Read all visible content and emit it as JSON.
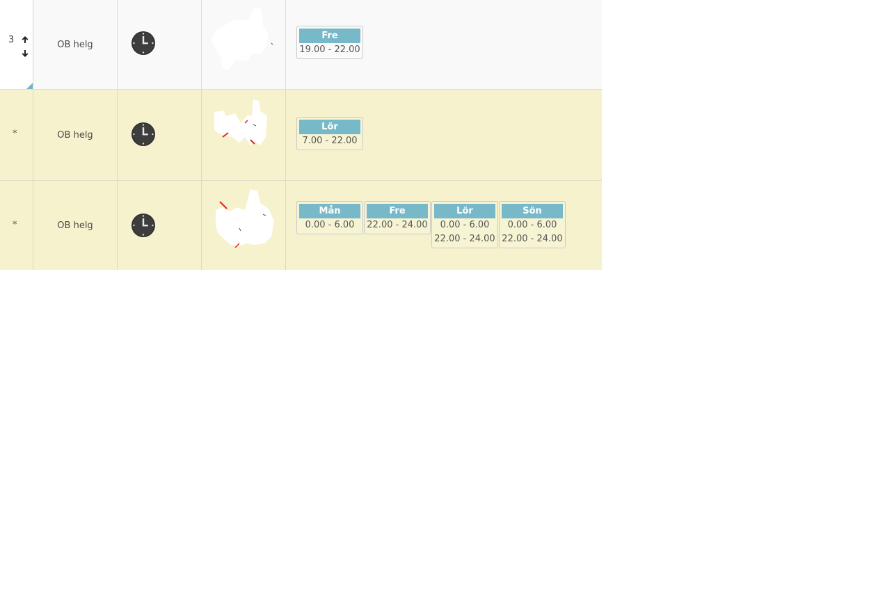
{
  "rows": [
    {
      "index": "3",
      "marker": "",
      "name": "OB helg",
      "icon": "clock-icon",
      "days": [
        {
          "day": "Fre",
          "times": [
            "19.00 - 22.00"
          ]
        }
      ]
    },
    {
      "index": "",
      "marker": "*",
      "name": "OB helg",
      "icon": "clock-icon",
      "days": [
        {
          "day": "Lör",
          "times": [
            "7.00 - 22.00"
          ]
        }
      ]
    },
    {
      "index": "",
      "marker": "*",
      "name": "OB helg",
      "icon": "clock-icon",
      "days": [
        {
          "day": "Mån",
          "times": [
            "0.00 - 6.00"
          ]
        },
        {
          "day": "Fre",
          "times": [
            "22.00 - 24.00"
          ]
        },
        {
          "day": "Lör",
          "times": [
            "0.00 - 6.00",
            "22.00 - 24.00"
          ]
        },
        {
          "day": "Sön",
          "times": [
            "0.00 - 6.00",
            "22.00 - 24.00"
          ]
        }
      ]
    }
  ],
  "colors": {
    "row_selected_bg": "#f9f9f9",
    "row_highlight_bg": "#f6f2cd",
    "day_header_bg": "#77b9c9",
    "corner_accent": "#6fb6c9"
  }
}
